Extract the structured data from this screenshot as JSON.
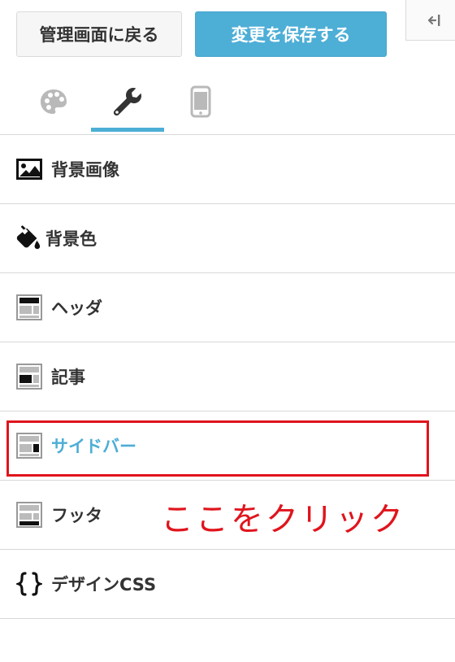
{
  "header": {
    "back_label": "管理画面に戻る",
    "save_label": "変更を保存する",
    "collapse_icon": "collapse-sidebar-icon"
  },
  "tabs": [
    {
      "icon": "palette-icon",
      "active": false
    },
    {
      "icon": "wrench-icon",
      "active": true
    },
    {
      "icon": "smartphone-icon",
      "active": false
    }
  ],
  "menu": {
    "items": [
      {
        "label": "背景画像",
        "icon": "image-icon"
      },
      {
        "label": "背景色",
        "icon": "paint-bucket-icon"
      },
      {
        "label": "ヘッダ",
        "icon": "layout-header-icon"
      },
      {
        "label": "記事",
        "icon": "layout-article-icon"
      },
      {
        "label": "サイドバー",
        "icon": "layout-sidebar-icon",
        "active": true
      },
      {
        "label": "フッタ",
        "icon": "layout-footer-icon"
      },
      {
        "label": "デザインCSS",
        "icon": "curly-braces-icon"
      }
    ]
  },
  "annotation": {
    "text": "ここをクリック",
    "color": "#e0141c"
  },
  "colors": {
    "accent": "#4daed6",
    "text": "#333333",
    "border": "#d8d8d8"
  }
}
